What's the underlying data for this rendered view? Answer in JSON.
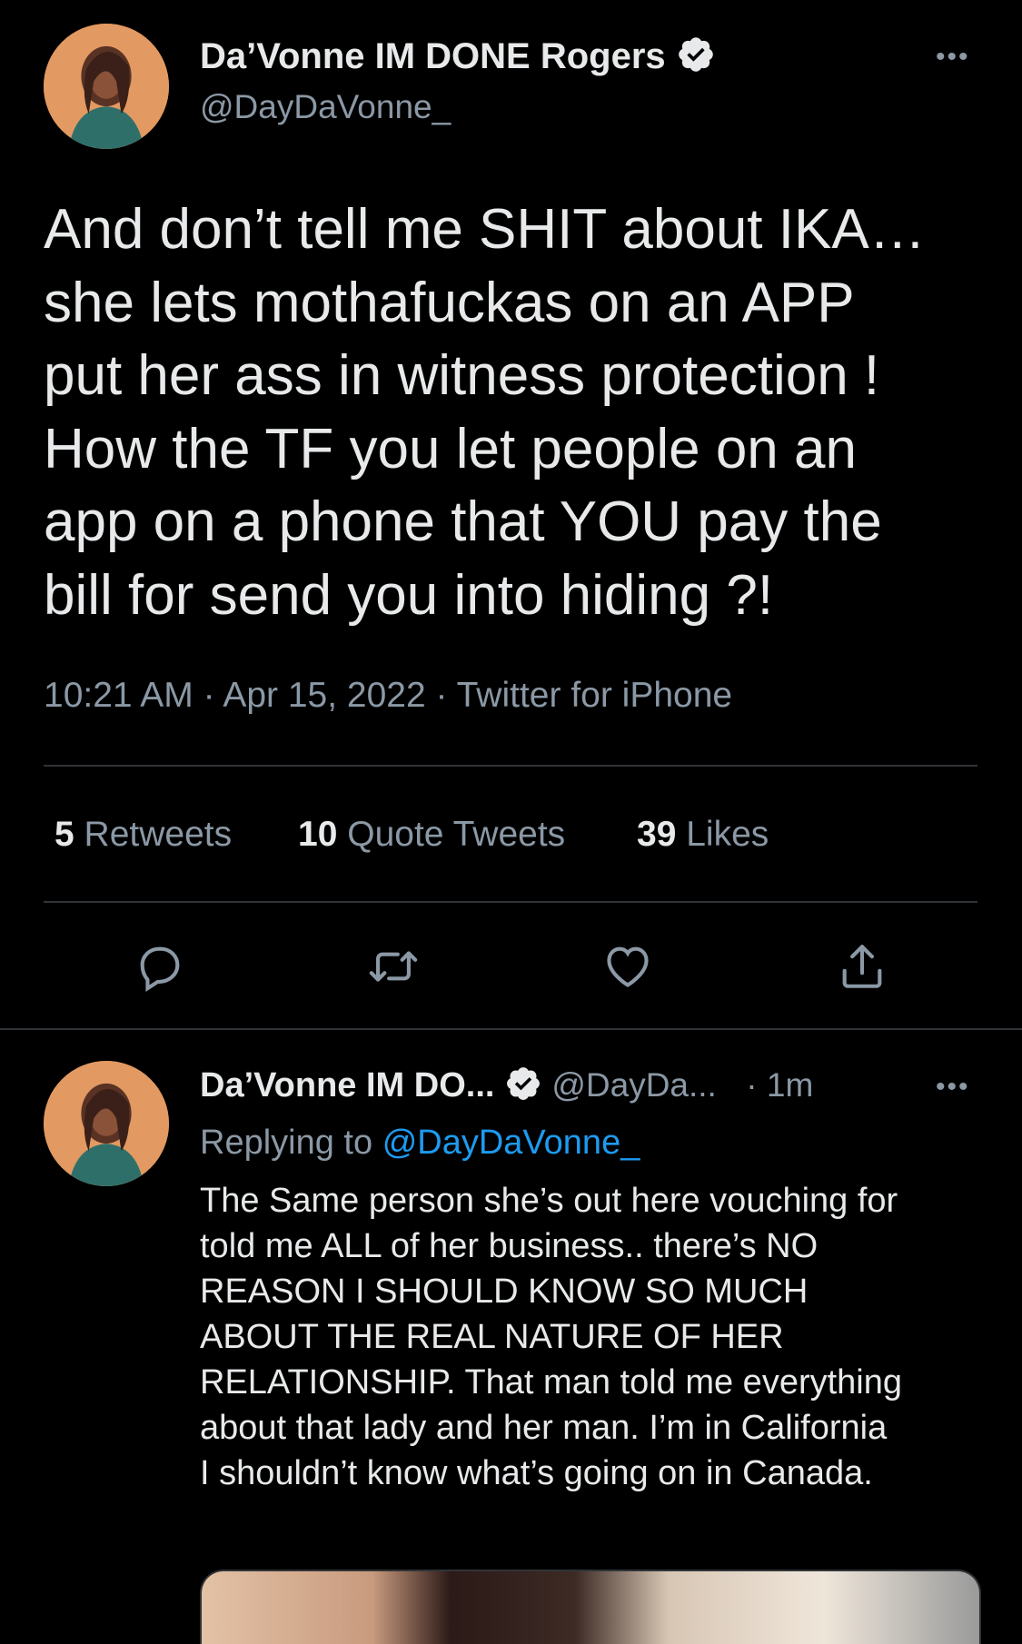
{
  "main_tweet": {
    "display_name": "Da’Vonne IM DONE Rogers",
    "handle": "@DayDaVonne_",
    "more_label": "•••",
    "text": "And don’t tell me SHIT about IKA…\nshe lets mothafuckas on an APP\nput her ass in witness protection !\nHow the TF you let people on an\napp on a phone that YOU pay the\nbill for send you into hiding ?!",
    "time": "10:21 AM",
    "date": "Apr 15, 2022",
    "source": "Twitter for iPhone",
    "separator": "·",
    "stats": {
      "retweets_count": "5",
      "retweets_label": "Retweets",
      "quotes_count": "10",
      "quotes_label": "Quote Tweets",
      "likes_count": "39",
      "likes_label": "Likes"
    },
    "actions": [
      "reply-icon",
      "retweet-icon",
      "like-icon",
      "share-icon"
    ]
  },
  "reply_tweet": {
    "display_name": "Da’Vonne IM DO...",
    "handle": "@DayDa...",
    "age": "· 1m",
    "more_label": "•••",
    "replying_prefix": "Replying to",
    "replying_to": "@DayDaVonne_",
    "text": "The Same person she’s out here vouching for\ntold me ALL of her business.. there’s NO\nREASON I SHOULD KNOW SO MUCH\nABOUT THE REAL NATURE OF HER\nRELATIONSHIP. That man told me everything\nabout that lady and her man. I’m in California\nI shouldn’t know what’s going on in Canada."
  },
  "colors": {
    "background": "#000000",
    "text": "#e7e9ea",
    "secondary": "#8b98a5",
    "link": "#1d9bf0",
    "divider": "#2f3336"
  }
}
